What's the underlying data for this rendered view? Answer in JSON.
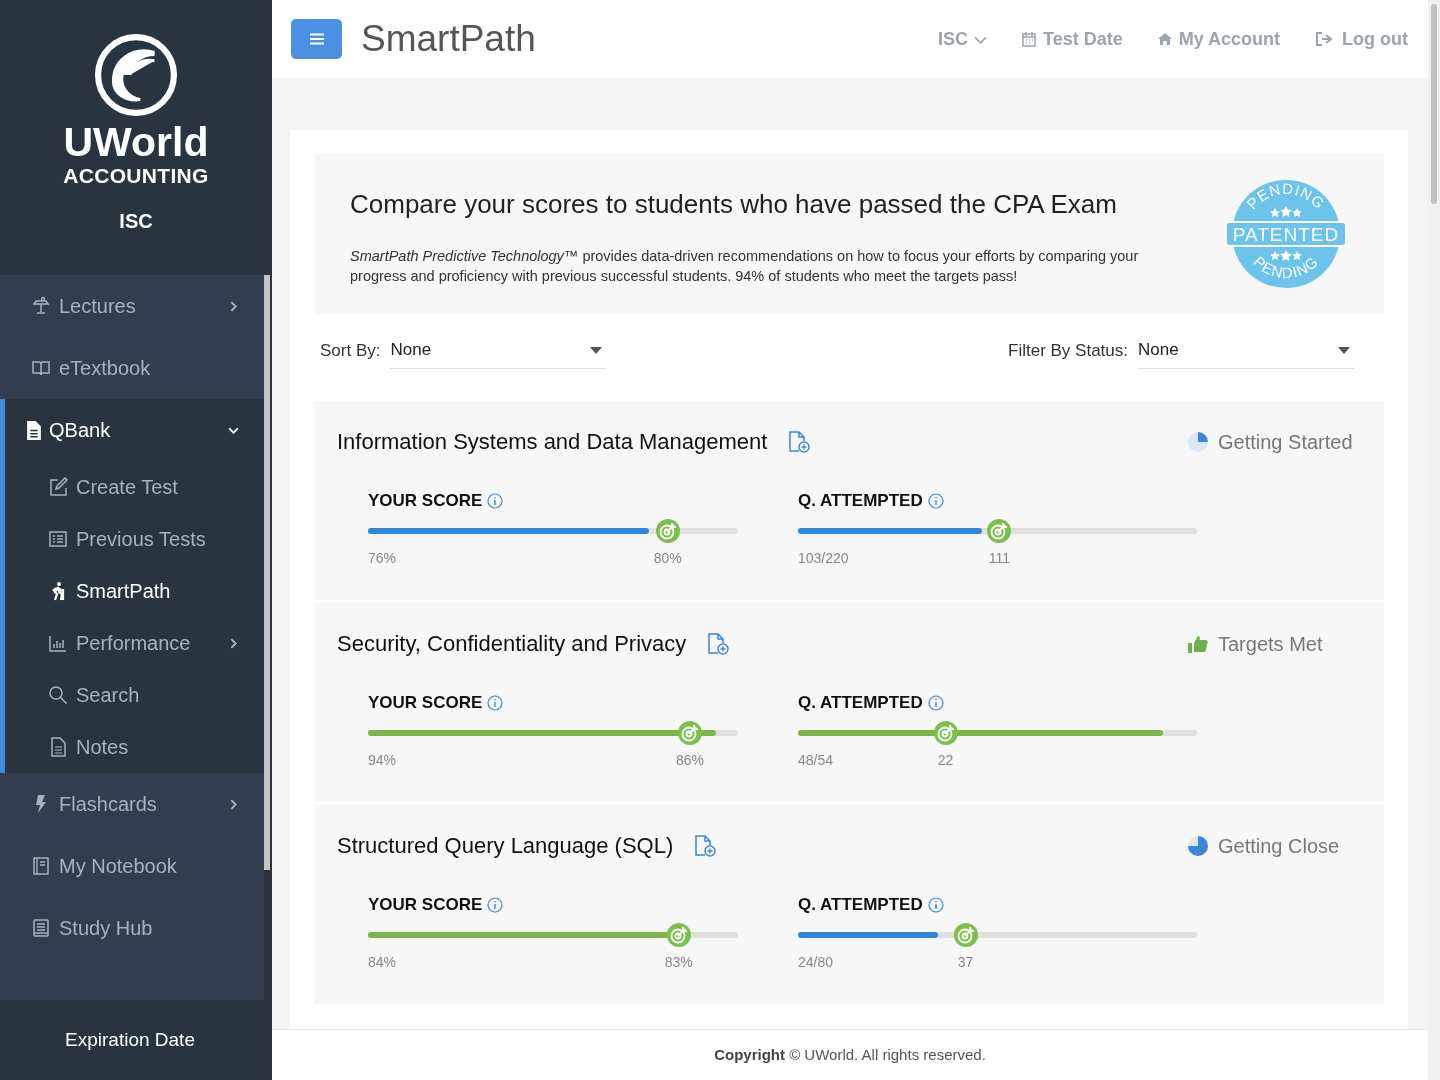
{
  "sidebar": {
    "logo": {
      "brand": "UWorld",
      "division": "ACCOUNTING"
    },
    "exam": "ISC",
    "groups": [
      {
        "items": [
          {
            "label": "Lectures",
            "has_submenu": true,
            "selected": false
          },
          {
            "label": "eTextbook",
            "has_submenu": false,
            "selected": false
          }
        ]
      },
      {
        "items": [
          {
            "label": "QBank",
            "has_submenu": true,
            "expanded": true,
            "selected": true,
            "children": [
              {
                "label": "Create Test",
                "has_submenu": false,
                "selected": false
              },
              {
                "label": "Previous Tests",
                "has_submenu": false,
                "selected": false
              },
              {
                "label": "SmartPath",
                "has_submenu": false,
                "selected": true
              },
              {
                "label": "Performance",
                "has_submenu": true,
                "selected": false
              },
              {
                "label": "Search",
                "has_submenu": false,
                "selected": false
              },
              {
                "label": "Notes",
                "has_submenu": false,
                "selected": false
              }
            ]
          }
        ]
      },
      {
        "items": [
          {
            "label": "Flashcards",
            "has_submenu": true,
            "selected": false
          },
          {
            "label": "My Notebook",
            "has_submenu": false,
            "selected": false
          },
          {
            "label": "Study Hub",
            "has_submenu": false,
            "selected": false
          }
        ]
      }
    ],
    "footer": "Expiration Date"
  },
  "header": {
    "title": "SmartPath",
    "nav": [
      {
        "label": "ISC",
        "kind": "dropdown"
      },
      {
        "label": "Test Date",
        "kind": "calendar"
      },
      {
        "label": "My Account",
        "kind": "home"
      },
      {
        "label": "Log out",
        "kind": "logout"
      }
    ]
  },
  "banner": {
    "title": "Compare your scores to students who have passed the CPA Exam",
    "text": "*SmartPath Predictive Technology™* provides data-driven recommendations on how to focus your efforts by comparing your progress and proficiency with previous successful students. 94% of students who meet the targets pass!",
    "seal": {
      "top": "PENDING",
      "middle": "PATENTED",
      "bottom": "PENDING"
    }
  },
  "filters": [
    {
      "label": "Sort By:",
      "value": "None"
    },
    {
      "label": "Filter By Status:",
      "value": "None"
    }
  ],
  "sections": [
    {
      "name": "Information Systems and Data Management",
      "status": {
        "label": "Getting Started",
        "kind": "started"
      },
      "metrics": [
        {
          "label": "YOUR SCORE",
          "level": 0.76,
          "value": "76%",
          "met": false,
          "target": {
            "label": "80%",
            "level": 0.81
          }
        },
        {
          "label": "Q. ATTEMPTED",
          "level": 0.46,
          "value": "103/220",
          "met": false,
          "target": {
            "label": "111",
            "level": 0.505
          }
        }
      ]
    },
    {
      "name": "Security, Confidentiality and Privacy",
      "status": {
        "label": "Targets Met",
        "kind": "met"
      },
      "metrics": [
        {
          "label": "YOUR SCORE",
          "level": 0.94,
          "value": "94%",
          "met": true,
          "target": {
            "label": "86%",
            "level": 0.87
          }
        },
        {
          "label": "Q. ATTEMPTED",
          "level": 0.915,
          "value": "48/54",
          "met": true,
          "target": {
            "label": "22",
            "level": 0.37
          }
        }
      ]
    },
    {
      "name": "Structured Query Language (SQL)",
      "status": {
        "label": "Getting Close",
        "kind": "close"
      },
      "metrics": [
        {
          "label": "YOUR SCORE",
          "level": 0.84,
          "value": "84%",
          "met": true,
          "target": {
            "label": "83%",
            "level": 0.84
          }
        },
        {
          "label": "Q. ATTEMPTED",
          "level": 0.35,
          "value": "24/80",
          "met": false,
          "target": {
            "label": "37",
            "level": 0.42
          }
        }
      ]
    }
  ],
  "footer": {
    "text": "**Copyright** © UWorld. All rights reserved."
  }
}
